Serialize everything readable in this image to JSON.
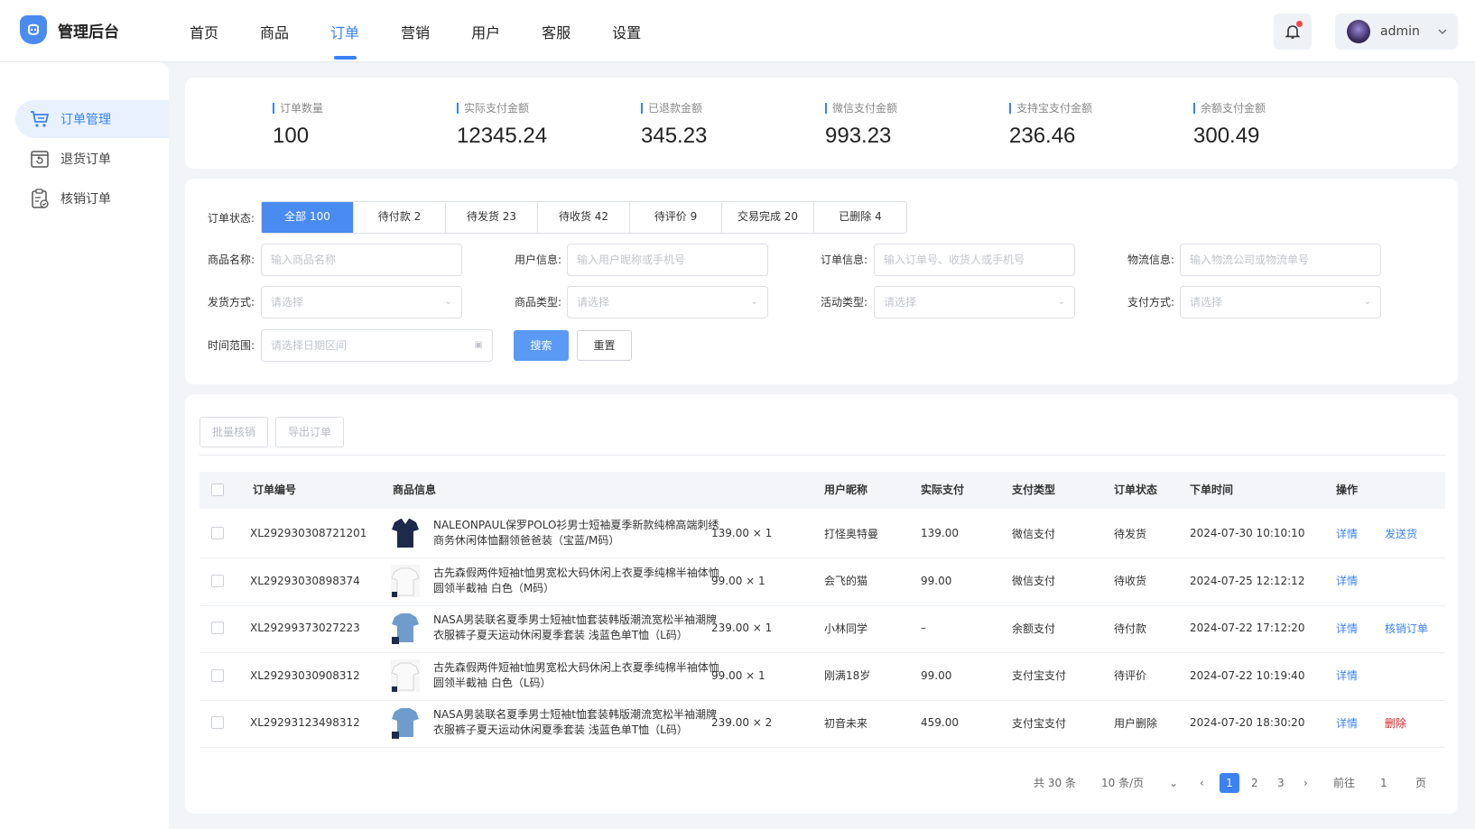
{
  "app": {
    "title": "管理后台"
  },
  "nav": [
    "首页",
    "商品",
    "订单",
    "营销",
    "用户",
    "客服",
    "设置"
  ],
  "nav_active": "订单",
  "user": {
    "name": "admin"
  },
  "sidebar": [
    "订单管理",
    "退货订单",
    "核销订单"
  ],
  "stats": [
    {
      "label": "订单数量",
      "value": "100"
    },
    {
      "label": "实际支付金额",
      "value": "12345.24"
    },
    {
      "label": "已退款金额",
      "value": "345.23"
    },
    {
      "label": "微信支付金额",
      "value": "993.23"
    },
    {
      "label": "支持宝支付金额",
      "value": "236.46"
    },
    {
      "label": "余额支付金额",
      "value": "300.49"
    }
  ],
  "filter": {
    "status_label": "订单状态:",
    "tabs": [
      "全部 100",
      "待付款 2",
      "待发货 23",
      "待收货 42",
      "待评价 9",
      "交易完成 20",
      "已删除 4"
    ],
    "fields": [
      {
        "label": "商品名称:",
        "placeholder": "输入商品名称"
      },
      {
        "label": "用户信息:",
        "placeholder": "输入用户昵称或手机号"
      },
      {
        "label": "订单信息:",
        "placeholder": "输入订单号、收货人或手机号"
      },
      {
        "label": "物流信息:",
        "placeholder": "输入物流公司或物流单号"
      },
      {
        "label": "发货方式:",
        "placeholder": "请选择"
      },
      {
        "label": "商品类型:",
        "placeholder": "请选择"
      },
      {
        "label": "活动类型:",
        "placeholder": "请选择"
      },
      {
        "label": "支付方式:",
        "placeholder": "请选择"
      },
      {
        "label": "时间范围:",
        "placeholder": "请选择日期区间"
      }
    ],
    "search": "搜索",
    "reset": "重置"
  },
  "actions": {
    "batch": "批量核销",
    "export": "导出订单"
  },
  "table": {
    "headers": [
      "订单编号",
      "商品信息",
      "用户昵称",
      "实际支付",
      "支付类型",
      "订单状态",
      "下单时间",
      "操作"
    ],
    "rows": [
      {
        "id": "XL292930308721201",
        "name": "NALEONPAUL保罗POLO衫男士短袖夏季新款纯棉高端刺绣商务休闲体恤翻领爸爸装（宝蓝/M码）",
        "price": "139.00 × 1",
        "nick": "打怪奥特曼",
        "paid": "139.00",
        "pay": "微信支付",
        "status": "待发货",
        "time": "2024-07-30 10:10:10",
        "op1": "详情",
        "op2": "发送货",
        "op2_type": "link"
      },
      {
        "id": "XL29293030898374",
        "name": "古先森假两件短袖t恤男宽松大码休闲上衣夏季纯棉半袖体恤圆领半截袖 白色（M码）",
        "price": "99.00 × 1",
        "nick": "会飞的猫",
        "paid": "99.00",
        "pay": "微信支付",
        "status": "待收货",
        "time": "2024-07-25 12:12:12",
        "op1": "详情",
        "op2": "",
        "op2_type": "link"
      },
      {
        "id": "XL29299373027223",
        "name": "NASA男装联名夏季男士短袖t恤套装韩版潮流宽松半袖潮牌衣服裤子夏天运动休闲夏季套装 浅蓝色单T恤（L码）",
        "price": "239.00 × 1",
        "nick": "小林同学",
        "paid": "–",
        "pay": "余额支付",
        "status": "待付款",
        "time": "2024-07-22 17:12:20",
        "op1": "详情",
        "op2": "核销订单",
        "op2_type": "link"
      },
      {
        "id": "XL29293030908312",
        "name": "古先森假两件短袖t恤男宽松大码休闲上衣夏季纯棉半袖体恤圆领半截袖 白色（L码）",
        "price": "99.00 × 1",
        "nick": "刚满18岁",
        "paid": "99.00",
        "pay": "支付宝支付",
        "status": "待评价",
        "time": "2024-07-22 10:19:40",
        "op1": "详情",
        "op2": "",
        "op2_type": "link"
      },
      {
        "id": "XL29293123498312",
        "name": "NASA男装联名夏季男士短袖t恤套装韩版潮流宽松半袖潮牌衣服裤子夏天运动休闲夏季套装 浅蓝色单T恤（L码）",
        "price": "239.00 × 2",
        "nick": "初音未来",
        "paid": "459.00",
        "pay": "支付宝支付",
        "status": "用户删除",
        "time": "2024-07-20 18:30:20",
        "op1": "详情",
        "op2": "删除",
        "op2_type": "danger"
      }
    ]
  },
  "pagination": {
    "total": "共 30 条",
    "size": "10 条/页",
    "pages": [
      "1",
      "2",
      "3"
    ],
    "current": "1",
    "goto": "前往",
    "goto_value": "1",
    "unit": "页"
  },
  "colors": {
    "accent": "#3a82f6",
    "danger": "#e02020",
    "notify": "#f04848"
  },
  "icons": [
    "shield-logo-icon",
    "bell-icon",
    "chevron-down-icon",
    "cart-icon",
    "return-box-icon",
    "clipboard-check-icon",
    "calendar-icon",
    "chevron-left-icon",
    "chevron-right-icon"
  ]
}
